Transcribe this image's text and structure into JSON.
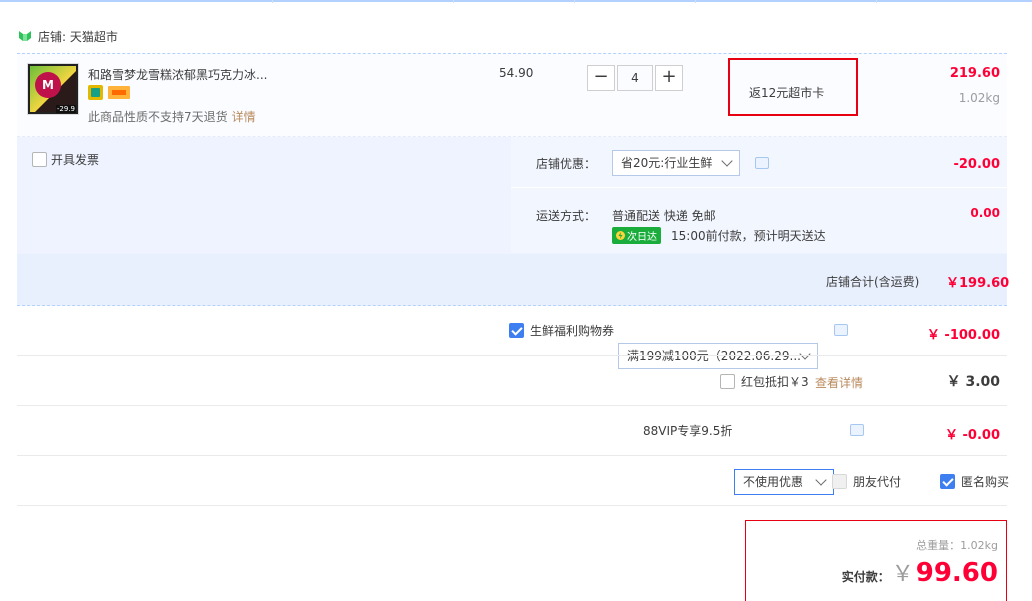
{
  "shop": {
    "label": "店铺: 天猫超市"
  },
  "item": {
    "name": "和路雪梦龙雪糕浓郁黑巧克力冰...",
    "thumb_letter": "M",
    "thumb_price": "-29.9",
    "no_return_text": "此商品性质不支持7天退货",
    "details_link": "详情",
    "unit_price": "54.90",
    "quantity": "4",
    "minus_label": "−",
    "plus_label": "+",
    "rebate": "返12元超市卡",
    "subtotal": "219.60",
    "weight": "1.02kg"
  },
  "invoice": {
    "label": "开具发票"
  },
  "shop_discount": {
    "label": "店铺优惠：",
    "selected": "省20元:行业生鲜",
    "amount": "-20.00"
  },
  "delivery": {
    "label": "运送方式：",
    "method": "普通配送 快递 免邮",
    "badge": "次日达",
    "note": "15:00前付款，预计明天送达",
    "amount": "0.00"
  },
  "shop_total": {
    "label": "店铺合计(含运费)",
    "amount": "￥199.60"
  },
  "coupon": {
    "label": "生鲜福利购物券",
    "selected": "满199减100元（2022.06.29...",
    "amount": "￥ -100.00",
    "checked": true
  },
  "redpacket": {
    "label": "红包抵扣￥3",
    "link": "查看详情",
    "amount": "￥ 3.00",
    "checked": false
  },
  "vip": {
    "label": "88VIP专享9.5折",
    "selected": "不使用优惠",
    "amount": "￥ -0.00"
  },
  "options": {
    "friend_pay": "朋友代付",
    "anonymous": "匿名购买",
    "anonymous_checked": true
  },
  "summary": {
    "weight_label": "总重量：1.02kg",
    "pay_label": "实付款：",
    "currency": "￥",
    "pay_amount": "99.60"
  },
  "colors": {
    "accent": "#ff0036",
    "blue": "#3d7ff0",
    "frame": "#e60012",
    "panel": "#eef3ff"
  }
}
